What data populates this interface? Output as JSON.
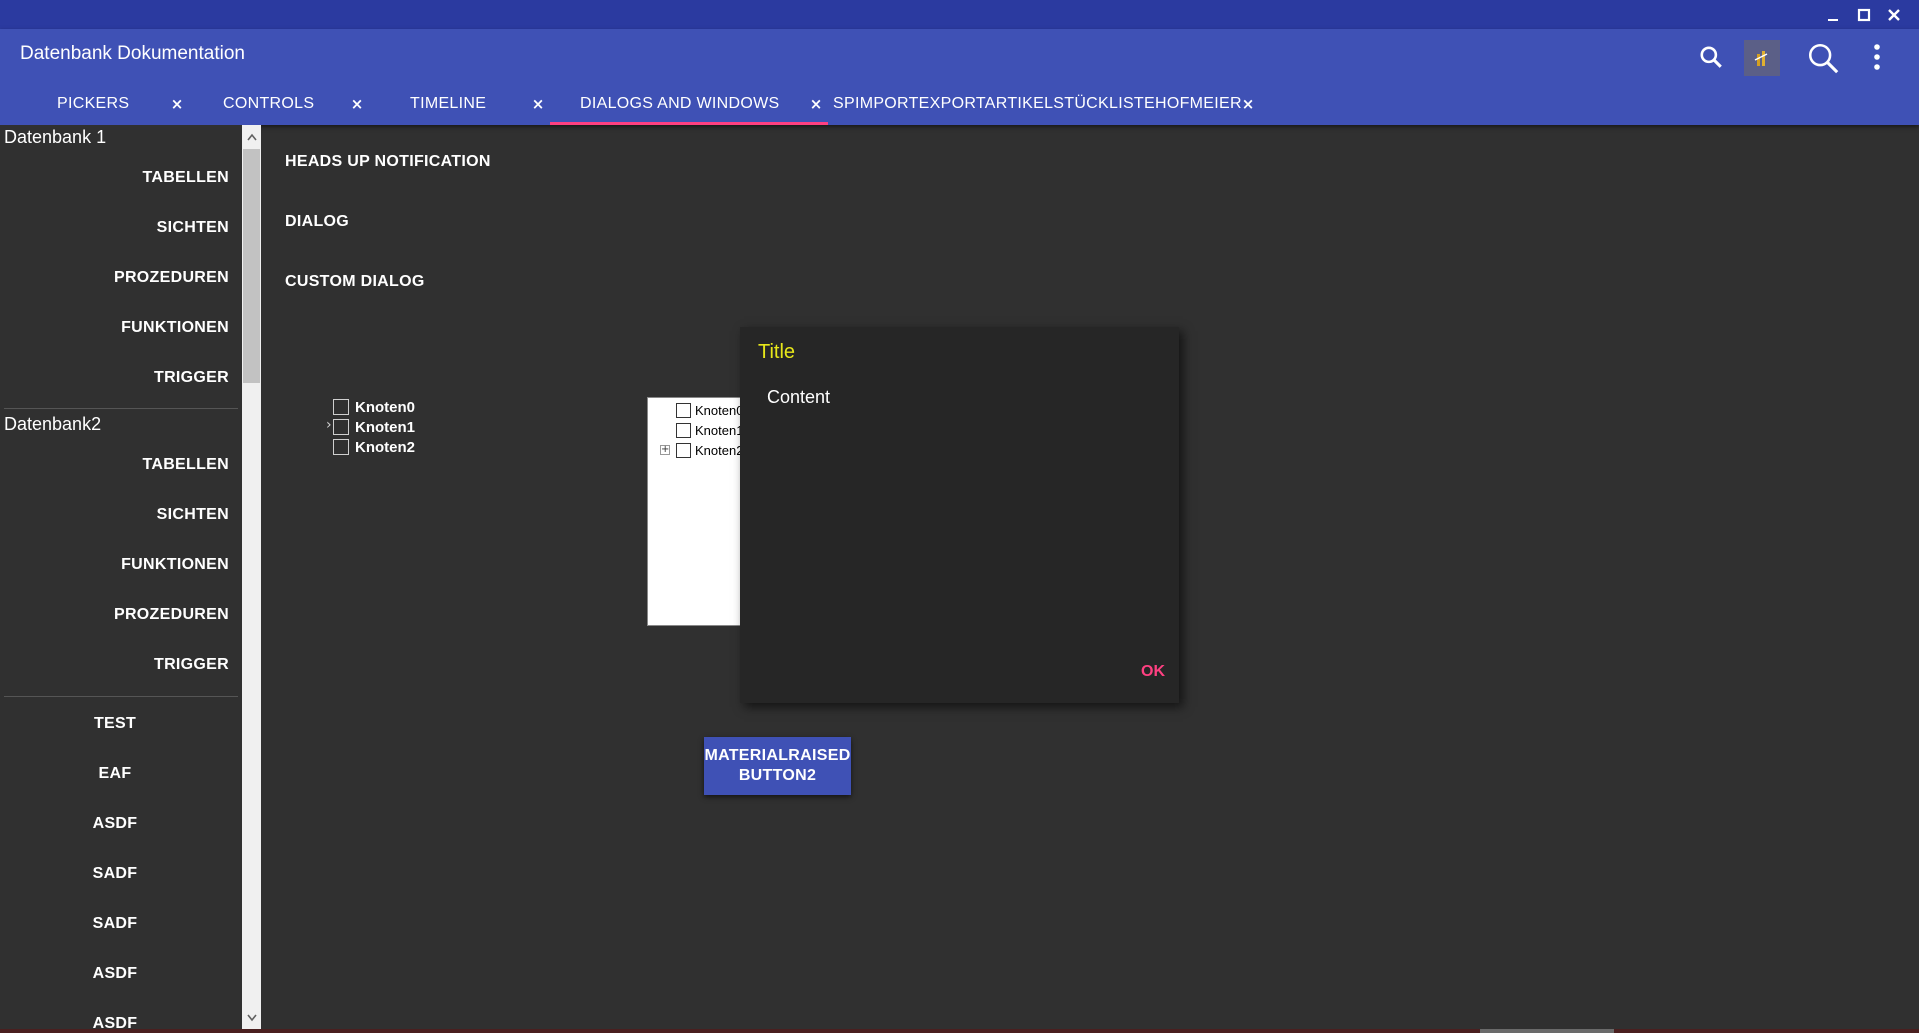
{
  "window": {
    "minimize_icon": "minimize-icon",
    "maximize_icon": "maximize-icon",
    "close_icon": "close-icon"
  },
  "appbar": {
    "title": "Datenbank Dokumentation",
    "icons": [
      "search-icon",
      "flash-icon",
      "search-large-icon",
      "more-vert-icon"
    ],
    "accent": "#3f51b5"
  },
  "tabs": [
    {
      "label": "PICKERS",
      "closable": true
    },
    {
      "label": "CONTROLS",
      "closable": true
    },
    {
      "label": "TIMELINE",
      "closable": true
    },
    {
      "label": "DIALOGS AND WINDOWS",
      "closable": true,
      "selected": true
    },
    {
      "label": "SPIMPORTEXPORTARTIKELSTÜCKLISTEHOFMEIER",
      "closable": true
    }
  ],
  "tab_close_glyph": "×",
  "sidebar": {
    "groups": [
      {
        "header": "Datenbank 1",
        "items": [
          "TABELLEN",
          "SICHTEN",
          "PROZEDUREN",
          "FUNKTIONEN",
          "TRIGGER"
        ]
      },
      {
        "header": "Datenbank2",
        "items": [
          "TABELLEN",
          "SICHTEN",
          "FUNKTIONEN",
          "PROZEDUREN",
          "TRIGGER"
        ]
      }
    ],
    "extra_items": [
      "TEST",
      "EAF",
      "ASDF",
      "SADF",
      "SADF",
      "ASDF",
      "ASDF"
    ]
  },
  "main": {
    "buttons": [
      "HEADS UP NOTIFICATION",
      "DIALOG",
      "CUSTOM DIALOG"
    ],
    "tree": [
      "Knoten0",
      "Knoten1",
      "Knoten2"
    ],
    "winforms_tree": [
      "Knoten0",
      "Knoten1",
      "Knoten2"
    ],
    "raised_button": "MATERIALRAISED BUTTON2"
  },
  "dialog": {
    "title": "Title",
    "content": "Content",
    "ok_label": "OK",
    "title_color": "#e6e61a",
    "ok_color": "#ff4081"
  }
}
